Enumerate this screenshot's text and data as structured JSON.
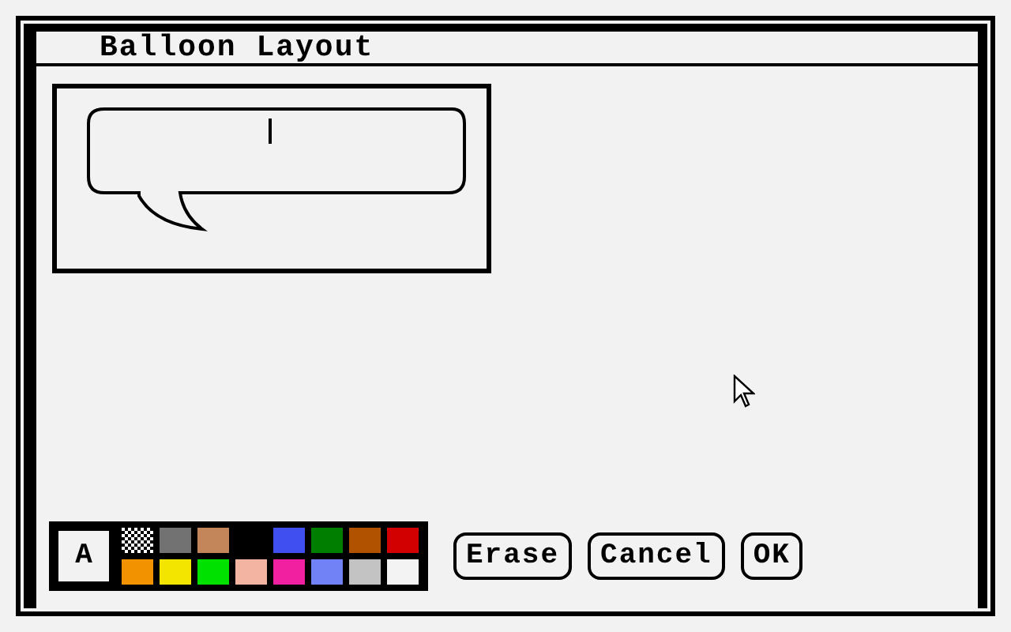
{
  "window": {
    "title": "Balloon Layout"
  },
  "palette": {
    "text_swatch": "A",
    "swatches": [
      {
        "kind": "pattern"
      },
      {
        "kind": "solid",
        "color": "#727272"
      },
      {
        "kind": "solid",
        "color": "#c3865a"
      },
      {
        "kind": "empty"
      },
      {
        "kind": "solid",
        "color": "#4050f0"
      },
      {
        "kind": "solid",
        "color": "#007e00"
      },
      {
        "kind": "solid",
        "color": "#b05200"
      },
      {
        "kind": "solid",
        "color": "#d20000"
      },
      {
        "kind": "solid",
        "color": "#f39200"
      },
      {
        "kind": "solid",
        "color": "#f3e500"
      },
      {
        "kind": "solid",
        "color": "#00e100"
      },
      {
        "kind": "solid",
        "color": "#f3b4a2"
      },
      {
        "kind": "solid",
        "color": "#f020a0"
      },
      {
        "kind": "solid",
        "color": "#7082f5"
      },
      {
        "kind": "solid",
        "color": "#c3c3c3"
      },
      {
        "kind": "solid",
        "color": "#f3f3f3"
      }
    ]
  },
  "buttons": [
    "Erase",
    "Cancel",
    "OK"
  ]
}
